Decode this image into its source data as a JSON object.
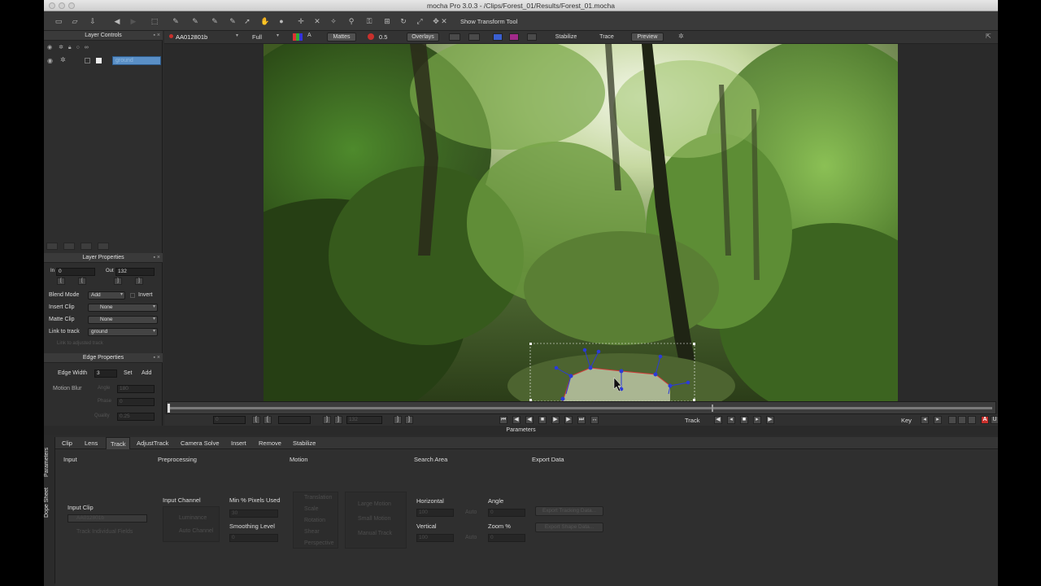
{
  "window": {
    "title": "mocha Pro 3.0.3 - /Clips/Forest_01/Results/Forest_01.mocha"
  },
  "toolbar": {
    "show_transform_label": "Show Transform Tool"
  },
  "viewer_toolbar": {
    "clip_name": "AA012801b",
    "zoom": "Full",
    "mattes_label": "Mattes",
    "matte_opacity": "0.5",
    "overlays_label": "Overlays",
    "stabilize_label": "Stabilize",
    "trace_label": "Trace",
    "preview_label": "Preview"
  },
  "layer_controls": {
    "title": "Layer Controls",
    "layer_name": "ground"
  },
  "layer_properties": {
    "title": "Layer Properties",
    "in_label": "In",
    "in_value": "0",
    "out_label": "Out",
    "out_value": "132",
    "blend_mode_label": "Blend Mode",
    "blend_mode_value": "Add",
    "invert_label": "Invert",
    "insert_clip_label": "Insert Clip",
    "insert_clip_value": "None",
    "matte_clip_label": "Matte Clip",
    "matte_clip_value": "None",
    "link_to_track_label": "Link to track",
    "link_to_track_value": "ground",
    "link_adjusted_label": "Link to adjusted track"
  },
  "edge_properties": {
    "title": "Edge Properties",
    "edge_width_label": "Edge Width",
    "edge_width_value": "3",
    "set_label": "Set",
    "add_label": "Add",
    "motion_blur_label": "Motion Blur",
    "angle_label": "Angle",
    "angle_value": "180",
    "phase_label": "Phase",
    "phase_value": "0",
    "quality_label": "Quality",
    "quality_value": "0.25"
  },
  "timeline": {
    "track_label": "Track",
    "key_label": "Key",
    "frame_in": "0",
    "frame_out": "132"
  },
  "parameters": {
    "title": "Parameters",
    "side_tabs": [
      "Parameters",
      "Dope Sheet"
    ],
    "tabs": [
      "Clip",
      "Lens",
      "Track",
      "AdjustTrack",
      "Camera Solve",
      "Insert",
      "Remove",
      "Stabilize"
    ],
    "active_tab": "Track",
    "sections": {
      "input": "Input",
      "preprocessing": "Preprocessing",
      "motion": "Motion",
      "search_area": "Search Area",
      "export_data": "Export Data"
    },
    "input_clip_label": "Input Clip",
    "input_clip_value": "AA012801b",
    "track_individual_fields": "Track Individual Fields",
    "input_channel_label": "Input Channel",
    "luminance_label": "Luminance",
    "auto_channel_label": "Auto Channel",
    "min_pixels_label": "Min % Pixels Used",
    "min_pixels_value": "30",
    "smoothing_label": "Smoothing Level",
    "smoothing_value": "0",
    "motion_options": [
      "Translation",
      "Scale",
      "Rotation",
      "Shear",
      "Perspective"
    ],
    "motion_modes": [
      "Large Motion",
      "Small Motion",
      "Manual Track"
    ],
    "horizontal_label": "Horizontal",
    "horizontal_value": "100",
    "vertical_label": "Vertical",
    "vertical_value": "100",
    "auto_label": "Auto",
    "angle_label": "Angle",
    "angle_value": "0",
    "zoom_label": "Zoom %",
    "zoom_value": "0",
    "export_tracking_label": "Export Tracking Data...",
    "export_shape_label": "Export Shape Data..."
  },
  "colors": {
    "accent_blue": "#5a8fc6",
    "spline_blue": "#2b3bd8",
    "spline_red": "#d23a3a",
    "key_red": "#c8302c"
  }
}
